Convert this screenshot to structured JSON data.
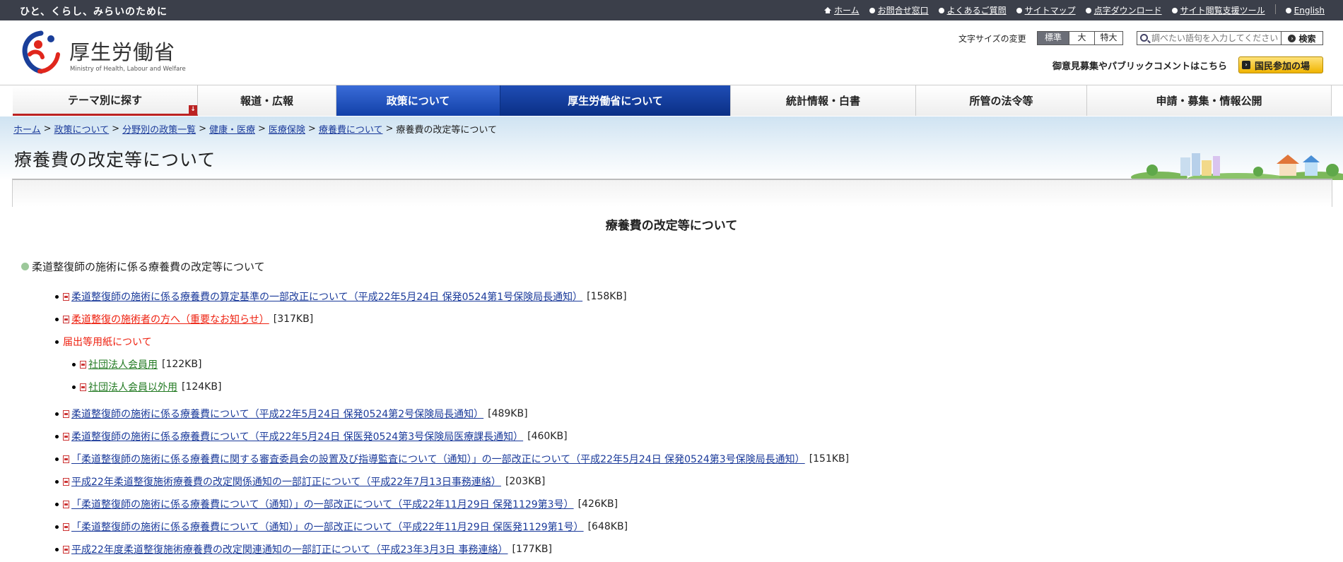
{
  "topbar": {
    "tagline": "ひと、くらし、みらいのために",
    "links": [
      "ホーム",
      "お問合せ窓口",
      "よくあるご質問",
      "サイトマップ",
      "点字ダウンロード",
      "サイト閲覧支援ツール",
      "English"
    ]
  },
  "header": {
    "logo_title": "厚生労働省",
    "logo_sub": "Ministry of Health, Labour and Welfare",
    "fontsize_label": "文字サイズの変更",
    "fontsize_options": [
      "標準",
      "大",
      "特大"
    ],
    "search_placeholder": "調べたい語句を入力してください",
    "search_button": "検索",
    "public_comment": "御意見募集やパブリックコメントはこちら",
    "participate_button": "国民参加の場"
  },
  "nav": [
    "テーマ別に探す",
    "報道・広報",
    "政策について",
    "厚生労働省について",
    "統計情報・白書",
    "所管の法令等",
    "申請・募集・情報公開"
  ],
  "breadcrumb": {
    "links": [
      "ホーム",
      "政策について",
      "分野別の政策一覧",
      "健康・医療",
      "医療保険",
      "療養費について"
    ],
    "current": "療養費の改定等について"
  },
  "page_title": "療養費の改定等について",
  "content": {
    "heading": "療養費の改定等について",
    "section_heading": "柔道整復師の施術に係る療養費の改定等について",
    "items": [
      {
        "text": "柔道整復師の施術に係る療養費の算定基準の一部改正について（平成22年5月24日 保発0524第1号保険局長通知）",
        "size": "[158KB]"
      },
      {
        "text": "柔道整復の施術者の方へ（重要なお知らせ）",
        "size": "[317KB]"
      },
      {
        "text": "届出等用紙について"
      },
      {
        "text": "社団法人会員用",
        "size": "[122KB]"
      },
      {
        "text": "社団法人会員以外用",
        "size": "[124KB]"
      },
      {
        "text": "柔道整復師の施術に係る療養費について（平成22年5月24日 保発0524第2号保険局長通知）",
        "size": "[489KB]"
      },
      {
        "text": "柔道整復師の施術に係る療養費について（平成22年5月24日 保医発0524第3号保険局医療課長通知）",
        "size": "[460KB]"
      },
      {
        "text": "「柔道整復師の施術に係る療養費に関する審査委員会の設置及び指導監査について（通知）」の一部改正について（平成22年5月24日 保発0524第3号保険局長通知）",
        "size": "[151KB]"
      },
      {
        "text": "平成22年柔道整復施術療養費の改定関係通知の一部訂正について（平成22年7月13日事務連絡）",
        "size": "[203KB]"
      },
      {
        "text": "「柔道整復師の施術に係る療養費について（通知）」の一部改正について（平成22年11月29日 保発1129第3号）",
        "size": "[426KB]"
      },
      {
        "text": "「柔道整復師の施術に係る療養費について（通知）」の一部改正について（平成22年11月29日 保医発1129第1号）",
        "size": "[648KB]"
      },
      {
        "text": "平成22年度柔道整復施術療養費の改定関連通知の一部訂正について（平成23年3月3日 事務連絡）",
        "size": "[177KB]"
      }
    ]
  }
}
